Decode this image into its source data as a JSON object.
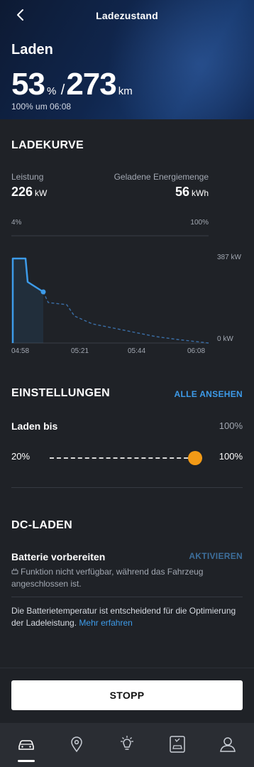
{
  "header": {
    "title": "Ladezustand",
    "status": "Laden",
    "soc_value": "53",
    "soc_unit": "%",
    "separator": "/",
    "range_value": "273",
    "range_unit": "km",
    "eta": "100% um 06:08"
  },
  "curve": {
    "title": "LADEKURVE",
    "power_label": "Leistung",
    "power_value": "226",
    "power_unit": "kW",
    "energy_label": "Geladene Energiemenge",
    "energy_value": "56",
    "energy_unit": "kWh",
    "range_start": "4%",
    "range_end": "100%",
    "y_max_label": "387 kW",
    "y_min_label": "0 kW",
    "times": [
      "04:58",
      "05:21",
      "05:44",
      "06:08"
    ]
  },
  "settings": {
    "title": "EINSTELLUNGEN",
    "see_all": "ALLE ANSEHEN",
    "charge_to_label": "Laden bis",
    "charge_to_value": "100%",
    "slider_min": "20%",
    "slider_max": "100%",
    "slider_level": 1.0
  },
  "dc": {
    "title": "DC-LADEN",
    "prepare_label": "Batterie vorbereiten",
    "activate": "AKTIVIEREN",
    "unavailable_note": "Funktion nicht verfügbar, während das Fahrzeug angeschlossen ist.",
    "info_text": "Die Batterietemperatur ist entscheidend für die Optimierung der Ladeleistung.",
    "learn_more": "Mehr erfahren"
  },
  "actions": {
    "stop": "STOPP"
  },
  "nav": {
    "icons": [
      "car-icon",
      "location-pin-icon",
      "lightbulb-icon",
      "vehicle-service-icon",
      "profile-icon"
    ]
  },
  "colors": {
    "accent_blue": "#3d9be9",
    "slider_orange": "#f29a16",
    "background": "#1f2227"
  }
}
